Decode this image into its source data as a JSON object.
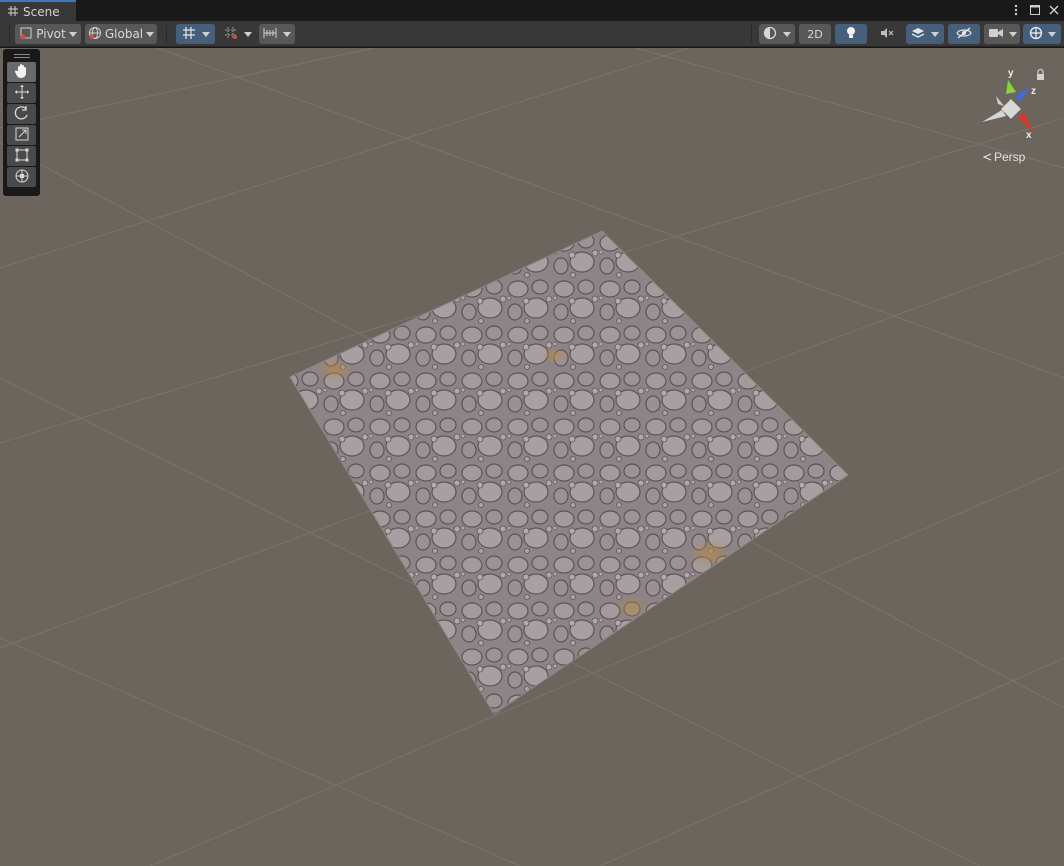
{
  "window": {
    "tab_label": "Scene",
    "tab_icon": "hash-icon",
    "controls": [
      "more-icon",
      "maximize-icon",
      "close-icon"
    ]
  },
  "toolbar": {
    "pivot_label": "Pivot",
    "global_label": "Global",
    "mode_2d_label": "2D",
    "accent_color": "#46607c"
  },
  "tools": {
    "items": [
      "hand-icon",
      "move-icon",
      "rotate-icon",
      "scale-icon",
      "rect-icon",
      "transform-icon"
    ],
    "active": "hand-icon"
  },
  "gizmo": {
    "axis_y": "y",
    "axis_z": "z",
    "axis_x": "x",
    "projection_label": "Persp",
    "colors": {
      "y": "#8ad23c",
      "z": "#3a6ee6",
      "x": "#d13a2a"
    }
  },
  "scene": {
    "background_color": "#6c655e",
    "grid_color": "#7a736c",
    "plane_color": "#8e8588"
  }
}
